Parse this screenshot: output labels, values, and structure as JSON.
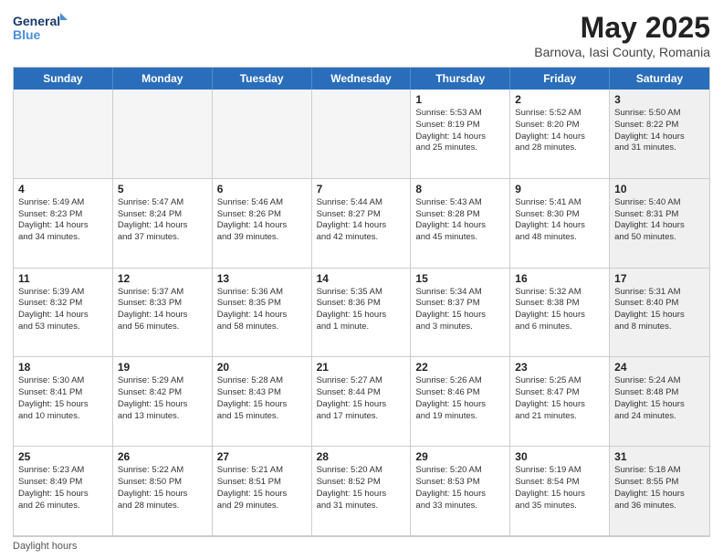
{
  "header": {
    "logo_line1": "General",
    "logo_line2": "Blue",
    "title": "May 2025",
    "subtitle": "Barnova, Iasi County, Romania"
  },
  "days": [
    "Sunday",
    "Monday",
    "Tuesday",
    "Wednesday",
    "Thursday",
    "Friday",
    "Saturday"
  ],
  "cells": [
    {
      "date": "",
      "info": "",
      "empty": true
    },
    {
      "date": "",
      "info": "",
      "empty": true
    },
    {
      "date": "",
      "info": "",
      "empty": true
    },
    {
      "date": "",
      "info": "",
      "empty": true
    },
    {
      "date": "1",
      "info": "Sunrise: 5:53 AM\nSunset: 8:19 PM\nDaylight: 14 hours\nand 25 minutes."
    },
    {
      "date": "2",
      "info": "Sunrise: 5:52 AM\nSunset: 8:20 PM\nDaylight: 14 hours\nand 28 minutes."
    },
    {
      "date": "3",
      "info": "Sunrise: 5:50 AM\nSunset: 8:22 PM\nDaylight: 14 hours\nand 31 minutes.",
      "saturday": true
    },
    {
      "date": "4",
      "info": "Sunrise: 5:49 AM\nSunset: 8:23 PM\nDaylight: 14 hours\nand 34 minutes."
    },
    {
      "date": "5",
      "info": "Sunrise: 5:47 AM\nSunset: 8:24 PM\nDaylight: 14 hours\nand 37 minutes."
    },
    {
      "date": "6",
      "info": "Sunrise: 5:46 AM\nSunset: 8:26 PM\nDaylight: 14 hours\nand 39 minutes."
    },
    {
      "date": "7",
      "info": "Sunrise: 5:44 AM\nSunset: 8:27 PM\nDaylight: 14 hours\nand 42 minutes."
    },
    {
      "date": "8",
      "info": "Sunrise: 5:43 AM\nSunset: 8:28 PM\nDaylight: 14 hours\nand 45 minutes."
    },
    {
      "date": "9",
      "info": "Sunrise: 5:41 AM\nSunset: 8:30 PM\nDaylight: 14 hours\nand 48 minutes."
    },
    {
      "date": "10",
      "info": "Sunrise: 5:40 AM\nSunset: 8:31 PM\nDaylight: 14 hours\nand 50 minutes.",
      "saturday": true
    },
    {
      "date": "11",
      "info": "Sunrise: 5:39 AM\nSunset: 8:32 PM\nDaylight: 14 hours\nand 53 minutes."
    },
    {
      "date": "12",
      "info": "Sunrise: 5:37 AM\nSunset: 8:33 PM\nDaylight: 14 hours\nand 56 minutes."
    },
    {
      "date": "13",
      "info": "Sunrise: 5:36 AM\nSunset: 8:35 PM\nDaylight: 14 hours\nand 58 minutes."
    },
    {
      "date": "14",
      "info": "Sunrise: 5:35 AM\nSunset: 8:36 PM\nDaylight: 15 hours\nand 1 minute."
    },
    {
      "date": "15",
      "info": "Sunrise: 5:34 AM\nSunset: 8:37 PM\nDaylight: 15 hours\nand 3 minutes."
    },
    {
      "date": "16",
      "info": "Sunrise: 5:32 AM\nSunset: 8:38 PM\nDaylight: 15 hours\nand 6 minutes."
    },
    {
      "date": "17",
      "info": "Sunrise: 5:31 AM\nSunset: 8:40 PM\nDaylight: 15 hours\nand 8 minutes.",
      "saturday": true
    },
    {
      "date": "18",
      "info": "Sunrise: 5:30 AM\nSunset: 8:41 PM\nDaylight: 15 hours\nand 10 minutes."
    },
    {
      "date": "19",
      "info": "Sunrise: 5:29 AM\nSunset: 8:42 PM\nDaylight: 15 hours\nand 13 minutes."
    },
    {
      "date": "20",
      "info": "Sunrise: 5:28 AM\nSunset: 8:43 PM\nDaylight: 15 hours\nand 15 minutes."
    },
    {
      "date": "21",
      "info": "Sunrise: 5:27 AM\nSunset: 8:44 PM\nDaylight: 15 hours\nand 17 minutes."
    },
    {
      "date": "22",
      "info": "Sunrise: 5:26 AM\nSunset: 8:46 PM\nDaylight: 15 hours\nand 19 minutes."
    },
    {
      "date": "23",
      "info": "Sunrise: 5:25 AM\nSunset: 8:47 PM\nDaylight: 15 hours\nand 21 minutes."
    },
    {
      "date": "24",
      "info": "Sunrise: 5:24 AM\nSunset: 8:48 PM\nDaylight: 15 hours\nand 24 minutes.",
      "saturday": true
    },
    {
      "date": "25",
      "info": "Sunrise: 5:23 AM\nSunset: 8:49 PM\nDaylight: 15 hours\nand 26 minutes."
    },
    {
      "date": "26",
      "info": "Sunrise: 5:22 AM\nSunset: 8:50 PM\nDaylight: 15 hours\nand 28 minutes."
    },
    {
      "date": "27",
      "info": "Sunrise: 5:21 AM\nSunset: 8:51 PM\nDaylight: 15 hours\nand 29 minutes."
    },
    {
      "date": "28",
      "info": "Sunrise: 5:20 AM\nSunset: 8:52 PM\nDaylight: 15 hours\nand 31 minutes."
    },
    {
      "date": "29",
      "info": "Sunrise: 5:20 AM\nSunset: 8:53 PM\nDaylight: 15 hours\nand 33 minutes."
    },
    {
      "date": "30",
      "info": "Sunrise: 5:19 AM\nSunset: 8:54 PM\nDaylight: 15 hours\nand 35 minutes."
    },
    {
      "date": "31",
      "info": "Sunrise: 5:18 AM\nSunset: 8:55 PM\nDaylight: 15 hours\nand 36 minutes.",
      "saturday": true
    }
  ],
  "footer": "Daylight hours"
}
